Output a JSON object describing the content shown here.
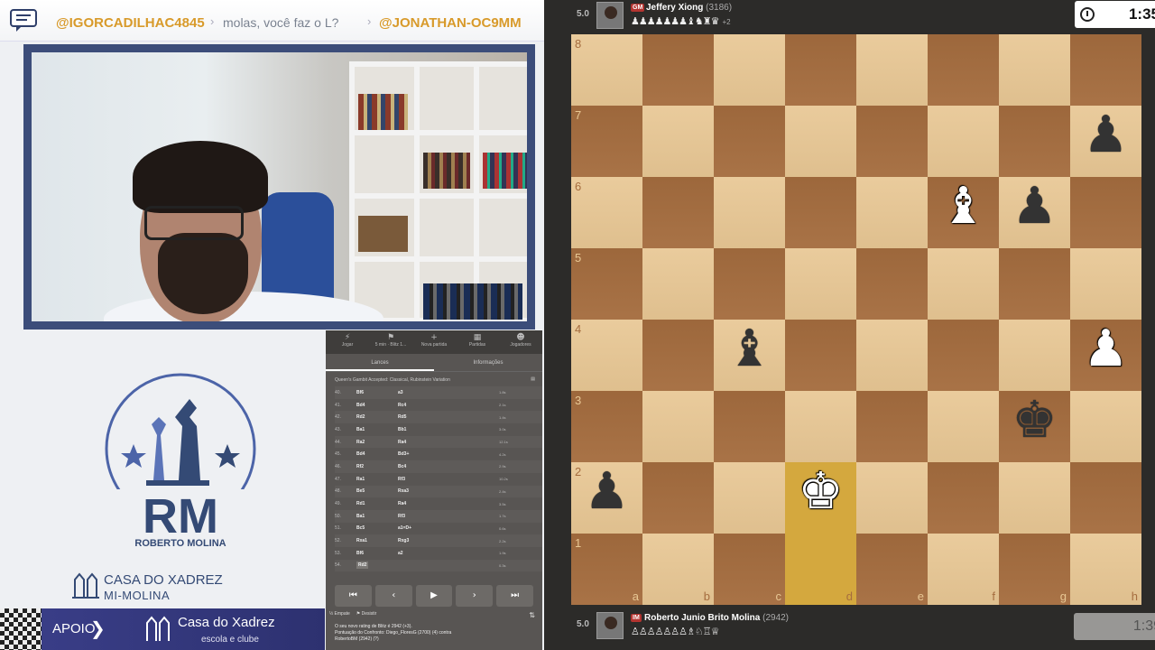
{
  "chat": {
    "user1": "@IGORCADILHAC4845",
    "message": "molas, você faz o L?",
    "user2": "@JONATHAN-OC9MM"
  },
  "brand": {
    "initials": "RM",
    "name": "ROBERTO MOLINA",
    "casa_title": "CASA DO XADREZ",
    "casa_sub": "MI-MOLINA"
  },
  "apoio": {
    "label": "APOIO",
    "arrow": "❯",
    "brand": "Casa do Xadrez",
    "sub": "escola e clube"
  },
  "chess_panel": {
    "tabs": [
      {
        "icon": "⚡",
        "label": "Jogar"
      },
      {
        "icon": "⚑",
        "label": "5 min · Blitz 1..."
      },
      {
        "icon": "+",
        "label": "Nova partida"
      },
      {
        "icon": "▦",
        "label": "Partidas"
      },
      {
        "icon": "☻",
        "label": "Jogadores"
      }
    ],
    "subtabs": [
      "Lances",
      "Informações"
    ],
    "opening": "Queen's Gambit Accepted: Classical, Rubinstein Variation",
    "moves": [
      {
        "n": "40.",
        "w": "Bf6",
        "b": "a3",
        "t": "1.8s"
      },
      {
        "n": "41.",
        "w": "Bd4",
        "b": "Rc4",
        "t": "2.1s"
      },
      {
        "n": "42.",
        "w": "Rd2",
        "b": "Rd5",
        "t": "1.4s"
      },
      {
        "n": "43.",
        "w": "Ba1",
        "b": "Bb1",
        "t": "3.0s"
      },
      {
        "n": "44.",
        "w": "Ra2",
        "b": "Ra4",
        "t": "12.1s"
      },
      {
        "n": "45.",
        "w": "Bd4",
        "b": "Bd3+",
        "t": "4.2s"
      },
      {
        "n": "46.",
        "w": "Rf2",
        "b": "Bc4",
        "t": "2.9s"
      },
      {
        "n": "47.",
        "w": "Ra1",
        "b": "Rf3",
        "t": "10.2s"
      },
      {
        "n": "48.",
        "w": "Be5",
        "b": "Rxa3",
        "t": "2.4s"
      },
      {
        "n": "49.",
        "w": "Rd1",
        "b": "Ra4",
        "t": "3.5s"
      },
      {
        "n": "50.",
        "w": "Ba1",
        "b": "Rf3",
        "t": "1.7s"
      },
      {
        "n": "51.",
        "w": "Bc5",
        "b": "a1=D+",
        "t": "0.6s"
      },
      {
        "n": "52.",
        "w": "Rxa1",
        "b": "Rxg3",
        "t": "2.2s"
      },
      {
        "n": "53.",
        "w": "Bf6",
        "b": "a2",
        "t": "1.9s"
      },
      {
        "n": "54.",
        "w": "Rd2",
        "b": "",
        "t": "0.3s"
      }
    ],
    "nav": [
      "⏮",
      "‹",
      "▶",
      "›",
      "⏭"
    ],
    "bottom": [
      "½ Empate",
      "⚑ Desistir"
    ],
    "footer": [
      "O seu novo rating de Blitz é 2942 (+3).",
      "Pontuação do Confronto: Diego_FloresG (2700) (4) contra",
      "RobertoBM (2942) (?)"
    ]
  },
  "top_player": {
    "score": "5.0",
    "title": "GM",
    "name": "Jeffery Xiong",
    "rating": "(3186)",
    "captures": "♟♟♟♟♟♟♟♝♞♜♛",
    "captures_extra": "+2",
    "clock": "1:35"
  },
  "bottom_player": {
    "score": "5.0",
    "title": "IM",
    "name": "Roberto Junio Brito Molina",
    "rating": "(2942)",
    "captures": "♙♙♙♙♙♙♙♗♘♖♕",
    "clock": "1:39"
  },
  "board": {
    "ranks": [
      "8",
      "7",
      "6",
      "5",
      "4",
      "3",
      "2",
      "1"
    ],
    "files": [
      "a",
      "b",
      "c",
      "d",
      "e",
      "f",
      "g",
      "h"
    ],
    "highlight": [
      "d1",
      "d2"
    ],
    "pieces": [
      {
        "sq": "h7",
        "glyph": "♟",
        "color": "black",
        "name": "black-pawn"
      },
      {
        "sq": "f6",
        "glyph": "♝",
        "color": "white",
        "name": "white-bishop"
      },
      {
        "sq": "g6",
        "glyph": "♟",
        "color": "black",
        "name": "black-pawn"
      },
      {
        "sq": "c4",
        "glyph": "♝",
        "color": "black",
        "name": "black-bishop"
      },
      {
        "sq": "h4",
        "glyph": "♟",
        "color": "white",
        "name": "white-pawn"
      },
      {
        "sq": "g3",
        "glyph": "♚",
        "color": "black",
        "name": "black-king"
      },
      {
        "sq": "a2",
        "glyph": "♟",
        "color": "black",
        "name": "black-pawn"
      },
      {
        "sq": "d2",
        "glyph": "♚",
        "color": "white",
        "name": "white-king"
      }
    ]
  }
}
